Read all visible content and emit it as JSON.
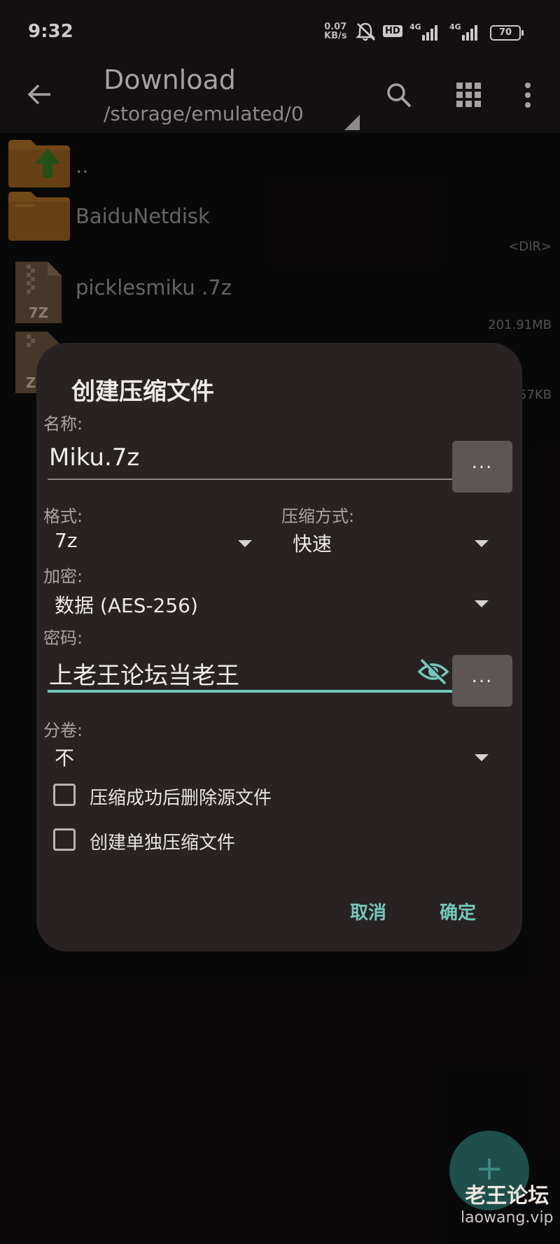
{
  "status_bar": {
    "time": "9:32",
    "net_speed_value": "0.07",
    "net_speed_unit": "KB/s",
    "hd_label": "HD",
    "signal1_label": "4G",
    "signal2_label": "4G",
    "battery": "70"
  },
  "appbar": {
    "title": "Download",
    "path": "/storage/emulated/0"
  },
  "files": [
    {
      "name": "..",
      "meta": "",
      "icon": "folder-up-icon"
    },
    {
      "name": "BaiduNetdisk",
      "meta": "<DIR>",
      "icon": "folder-icon"
    },
    {
      "name": "picklesmiku .7z",
      "meta": "201.91MB",
      "icon": "archive-7z-icon",
      "badge": "7Z"
    },
    {
      "name": "",
      "meta": "57KB",
      "icon": "archive-zip-icon",
      "badge": "Z"
    }
  ],
  "dialog": {
    "title": "创建压缩文件",
    "name_label": "名称:",
    "name_value": "Miku.7z",
    "browse_label": "...",
    "format_label": "格式:",
    "format_value": "7z",
    "method_label": "压缩方式:",
    "method_value": "快速",
    "encryption_label": "加密:",
    "encryption_value": "数据 (AES-256)",
    "password_label": "密码:",
    "password_value": "上老王论坛当老王",
    "password_browse_label": "...",
    "split_label": "分卷:",
    "split_value": "不",
    "delete_source_label": "压缩成功后删除源文件",
    "separate_archives_label": "创建单独压缩文件",
    "cancel_label": "取消",
    "ok_label": "确定"
  },
  "fab_label": "+",
  "watermark": {
    "cn": "老王论坛",
    "en": "laowang.vip"
  },
  "colors": {
    "accent": "#74c7bb",
    "dialog_bg": "#292222",
    "folder": "#c07a2c"
  }
}
